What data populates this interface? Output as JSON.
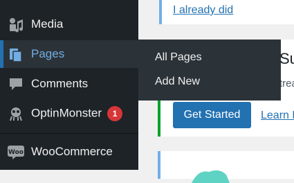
{
  "sidebar": {
    "items": [
      {
        "label": "Media",
        "icon": "media-icon"
      },
      {
        "label": "Pages",
        "icon": "pages-icon"
      },
      {
        "label": "Comments",
        "icon": "comments-icon"
      },
      {
        "label": "OptinMonster",
        "icon": "optinmonster-icon",
        "badge": "1"
      },
      {
        "label": "WooCommerce",
        "icon": "woocommerce-icon"
      }
    ]
  },
  "flyout": {
    "items": [
      "All Pages",
      "Add New"
    ]
  },
  "content": {
    "top_link": "I already did",
    "partial_title": "Su",
    "partial_text": "trea",
    "get_started": "Get Started",
    "learn_more": "Learn M"
  },
  "colors": {
    "sidebar_bg": "#1d2327",
    "accent": "#2271b1",
    "current_text": "#72aee6",
    "badge": "#d63638"
  }
}
